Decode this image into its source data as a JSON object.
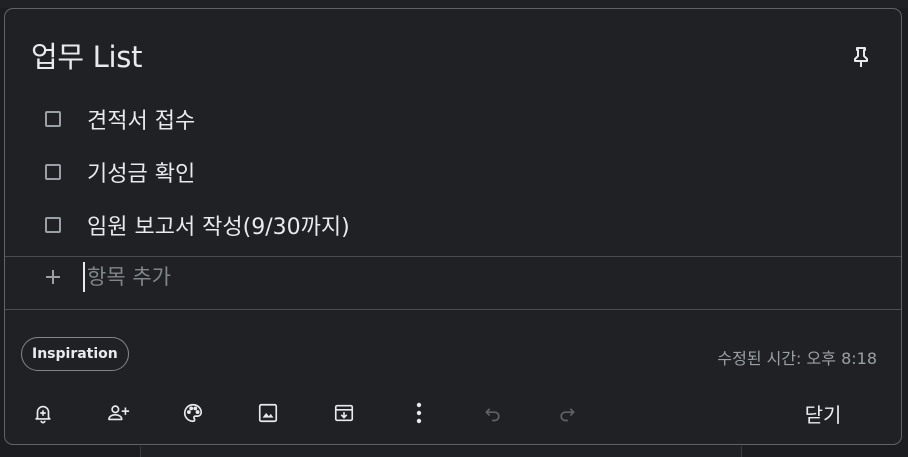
{
  "note": {
    "title": "업무 List",
    "checklist": [
      {
        "text": "견적서 접수",
        "checked": false
      },
      {
        "text": "기성금 확인",
        "checked": false
      },
      {
        "text": "임원 보고서 작성(9/30까지)",
        "checked": false
      }
    ],
    "add_item_placeholder": "항목 추가",
    "label": "Inspiration",
    "edited_time": "수정된 시간: 오후 8:18"
  },
  "toolbar": {
    "icons": [
      "reminder-icon",
      "collaborator-icon",
      "palette-icon",
      "image-icon",
      "archive-icon",
      "more-vert-icon",
      "undo-icon",
      "redo-icon"
    ],
    "close_label": "닫기"
  },
  "colors": {
    "background": "#202124",
    "border": "#5f6368",
    "text": "#e8eaed",
    "muted_text": "#9aa0a6"
  }
}
